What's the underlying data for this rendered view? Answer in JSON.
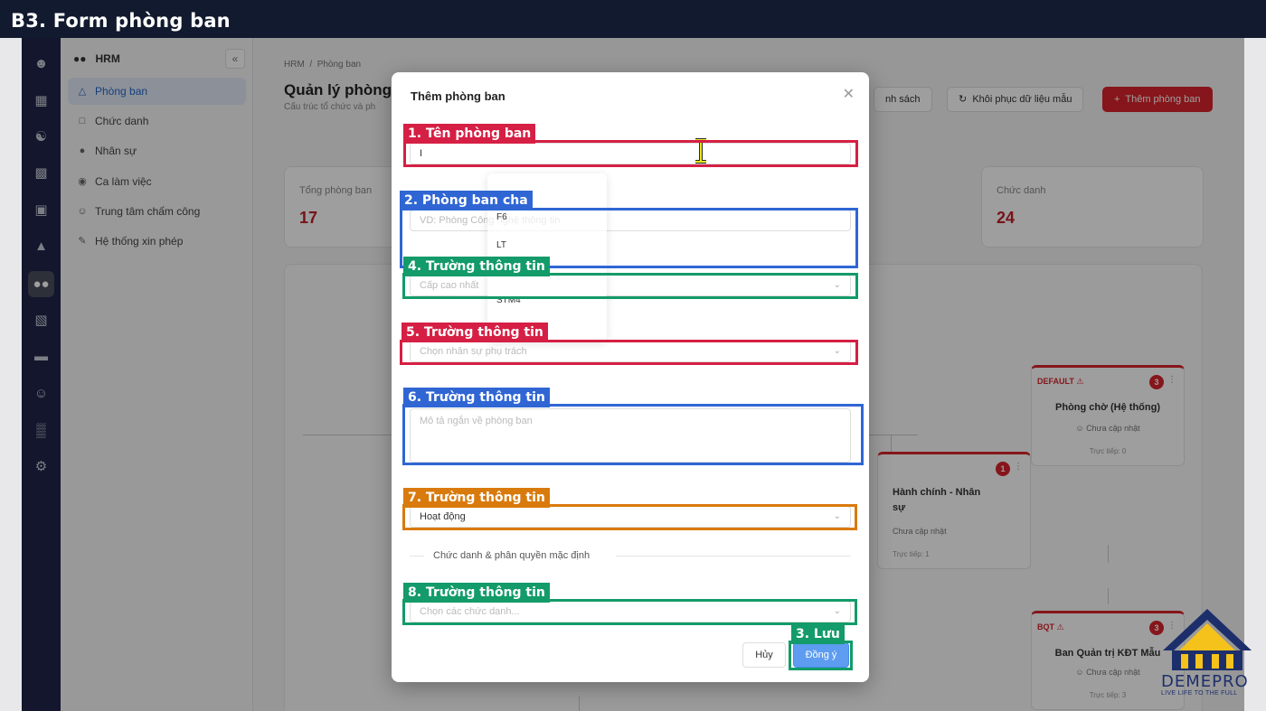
{
  "banner": {
    "title": "B3. Form phòng ban"
  },
  "sidebar": {
    "module": "HRM",
    "items": [
      {
        "label": "Phòng ban",
        "icon": "org-chart-icon",
        "active": true
      },
      {
        "label": "Chức danh",
        "icon": "document-icon"
      },
      {
        "label": "Nhân sự",
        "icon": "users-icon"
      },
      {
        "label": "Ca làm việc",
        "icon": "clock-icon"
      },
      {
        "label": "Trung tâm chấm công",
        "icon": "user-check-icon"
      },
      {
        "label": "Hệ thống xin phép",
        "icon": "request-icon"
      }
    ]
  },
  "page": {
    "breadcrumb_root": "HRM",
    "breadcrumb_current": "Phòng ban",
    "title": "Quản lý phòng",
    "subtitle": "Cấu trúc tổ chức và ph",
    "btn_list": "nh sách",
    "btn_restore": "Khôi phục dữ liệu mẫu",
    "btn_add": "Thêm phòng ban"
  },
  "stats": [
    {
      "label": "Tổng phòng ban",
      "value": "17"
    },
    {
      "label": "Chức danh",
      "value": "24"
    }
  ],
  "cards": {
    "default": {
      "code": "DEFAULT",
      "count": "3",
      "name": "Phòng chờ (Hệ thống)",
      "manager": "Chưa cập nhật",
      "direct": "Trực tiếp: 0"
    },
    "hr": {
      "count": "1",
      "name_line1": "Hành chính - Nhân",
      "name_line2": "sự",
      "manager": "Chưa cập nhật",
      "direct": "Trực tiếp: 1"
    },
    "bqt": {
      "code": "BQT",
      "count": "3",
      "name": "Ban Quản trị KĐT Mẫu",
      "manager": "Chưa cập nhật",
      "direct": "Trực tiếp: 3"
    }
  },
  "modal": {
    "title": "Thêm phòng ban",
    "name_value": "I",
    "parent_placeholder": "VD: Phòng Công nghệ thông tin",
    "level_placeholder": "Cấp cao nhất",
    "manager_placeholder": "Chọn nhân sự phụ trách",
    "desc_placeholder": "Mô tả ngắn về phòng ban",
    "status_value": "Hoạt động",
    "section_divider": "Chức danh & phân quyền mặc định",
    "roles_placeholder": "Chọn các chức danh...",
    "cancel": "Hủy",
    "ok": "Đồng ý"
  },
  "dropdown": {
    "options": [
      "F6",
      "LT",
      "STM4"
    ]
  },
  "annotations": [
    {
      "label": "1. Tên phòng ban",
      "color": "#d61f44"
    },
    {
      "label": "2. Phòng ban cha",
      "color": "#2f66d4"
    },
    {
      "label": "4. Trường thông tin",
      "color": "#139b6a"
    },
    {
      "label": "5. Trường thông tin",
      "color": "#d61f44"
    },
    {
      "label": "6. Trường thông tin",
      "color": "#2f66d4"
    },
    {
      "label": "7. Trường thông tin",
      "color": "#d97a0c"
    },
    {
      "label": "8. Trường thông tin",
      "color": "#139b6a"
    },
    {
      "label": "3. Lưu",
      "color": "#139b6a"
    }
  ],
  "logo": {
    "brand": "DEMEPRO",
    "slogan": "LIVE LIFE TO THE FULL",
    "colors": [
      "#1d2f6b",
      "#f4c21b"
    ]
  }
}
